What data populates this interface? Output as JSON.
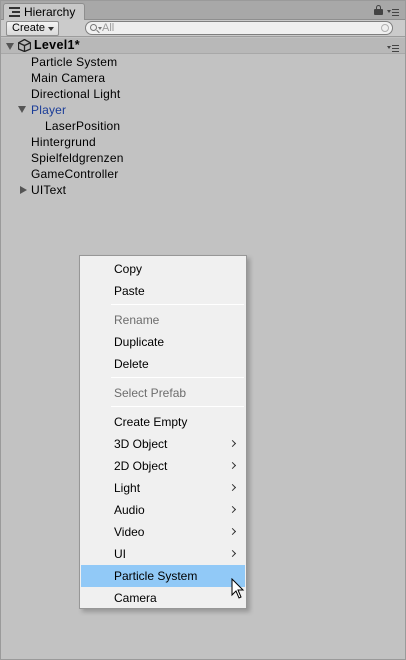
{
  "window": {
    "tab_label": "Hierarchy"
  },
  "toolbar": {
    "create_label": "Create",
    "search_placeholder": "All"
  },
  "scene": {
    "name": "Level1*"
  },
  "hierarchy": {
    "items": [
      {
        "label": "Particle System"
      },
      {
        "label": "Main Camera"
      },
      {
        "label": "Directional Light"
      },
      {
        "label": "Player"
      },
      {
        "label": "LaserPosition"
      },
      {
        "label": "Hintergrund"
      },
      {
        "label": "Spielfeldgrenzen"
      },
      {
        "label": "GameController"
      },
      {
        "label": "UIText"
      }
    ]
  },
  "context_menu": {
    "items": [
      {
        "label": "Copy"
      },
      {
        "label": "Paste"
      },
      {
        "label": "Rename"
      },
      {
        "label": "Duplicate"
      },
      {
        "label": "Delete"
      },
      {
        "label": "Select Prefab"
      },
      {
        "label": "Create Empty"
      },
      {
        "label": "3D Object"
      },
      {
        "label": "2D Object"
      },
      {
        "label": "Light"
      },
      {
        "label": "Audio"
      },
      {
        "label": "Video"
      },
      {
        "label": "UI"
      },
      {
        "label": "Particle System"
      },
      {
        "label": "Camera"
      }
    ]
  },
  "colors": {
    "panel_background": "#c2c2c2",
    "prefab_text": "#1a3c98",
    "menu_highlight": "#91c9f7",
    "disabled_text": "#6d6d6d"
  }
}
